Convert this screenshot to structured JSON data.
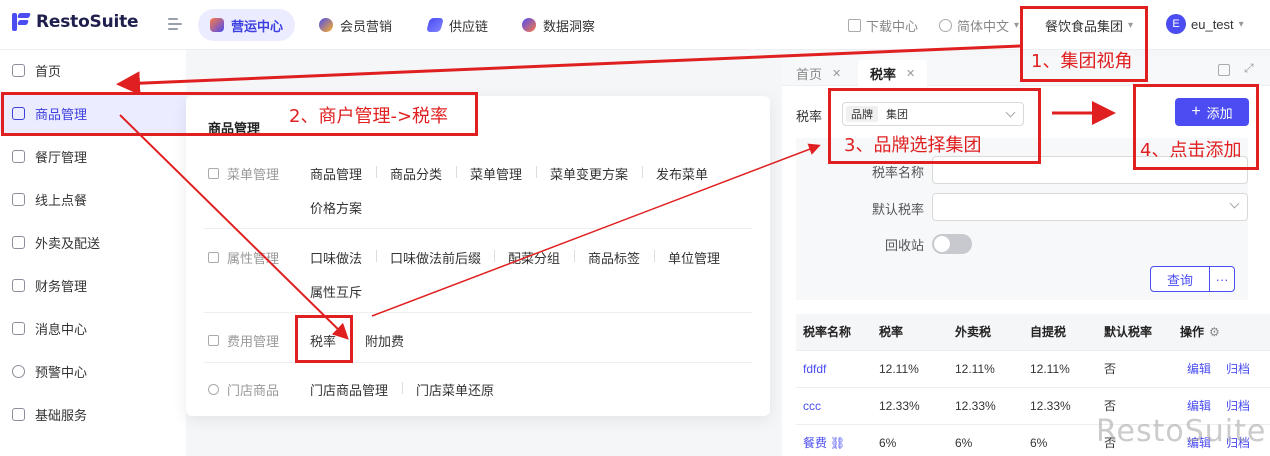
{
  "app": {
    "logo_text": "RestoSuite"
  },
  "nav": {
    "tabs": [
      {
        "label": "营运中心",
        "active": true
      },
      {
        "label": "会员营销"
      },
      {
        "label": "供应链"
      },
      {
        "label": "数据洞察"
      }
    ],
    "download": "下载中心",
    "language": "简体中文",
    "group": "餐饮食品集团",
    "user_initial": "E",
    "user": "eu_test"
  },
  "sidebar": {
    "items": [
      {
        "label": "首页"
      },
      {
        "label": "商品管理",
        "active": true
      },
      {
        "label": "餐厅管理"
      },
      {
        "label": "线上点餐"
      },
      {
        "label": "外卖及配送"
      },
      {
        "label": "财务管理"
      },
      {
        "label": "消息中心"
      },
      {
        "label": "预警中心"
      },
      {
        "label": "基础服务"
      }
    ]
  },
  "menu": {
    "title": "商品管理",
    "groups": [
      {
        "label": "菜单管理",
        "items": [
          "商品管理",
          "商品分类",
          "菜单管理",
          "菜单变更方案",
          "发布菜单",
          "价格方案"
        ]
      },
      {
        "label": "属性管理",
        "items": [
          "口味做法",
          "口味做法前后缀",
          "配菜分组",
          "商品标签",
          "单位管理",
          "属性互斥"
        ]
      },
      {
        "label": "费用管理",
        "items": [
          "税率",
          "附加费"
        ]
      },
      {
        "label": "门店商品",
        "items": [
          "门店商品管理",
          "门店菜单还原"
        ]
      }
    ]
  },
  "panel": {
    "tabs": [
      {
        "label": "首页"
      },
      {
        "label": "税率",
        "active": true
      }
    ],
    "top_label": "税率",
    "brand_tag": "品牌",
    "brand_value": "集团",
    "add_button": "添加",
    "filters": {
      "name_label": "税率名称",
      "default_label": "默认税率",
      "recycle_label": "回收站",
      "query_button": "查询",
      "more_button": "···"
    },
    "table": {
      "headers": [
        "税率名称",
        "税率",
        "外卖税",
        "自提税",
        "默认税率",
        "操作"
      ],
      "rows": [
        {
          "name": "fdfdf",
          "rate": "12.11%",
          "takeout": "12.11%",
          "pickup": "12.11%",
          "default": "否",
          "edit": "编辑",
          "archive": "归档"
        },
        {
          "name": "ccc",
          "rate": "12.33%",
          "takeout": "12.33%",
          "pickup": "12.33%",
          "default": "否",
          "edit": "编辑",
          "archive": "归档"
        },
        {
          "name": "餐费",
          "rate": "6%",
          "takeout": "6%",
          "pickup": "6%",
          "default": "否",
          "edit": "编辑",
          "archive": "归档"
        }
      ]
    }
  },
  "annotations": {
    "a1": "1、集团视角",
    "a2": "2、商户管理->税率",
    "a3": "3、品牌选择集团",
    "a4": "4、点击添加"
  },
  "watermark": "RestoSuite",
  "colors": {
    "accent": "#4b4df2",
    "annotation": "#e02020"
  }
}
